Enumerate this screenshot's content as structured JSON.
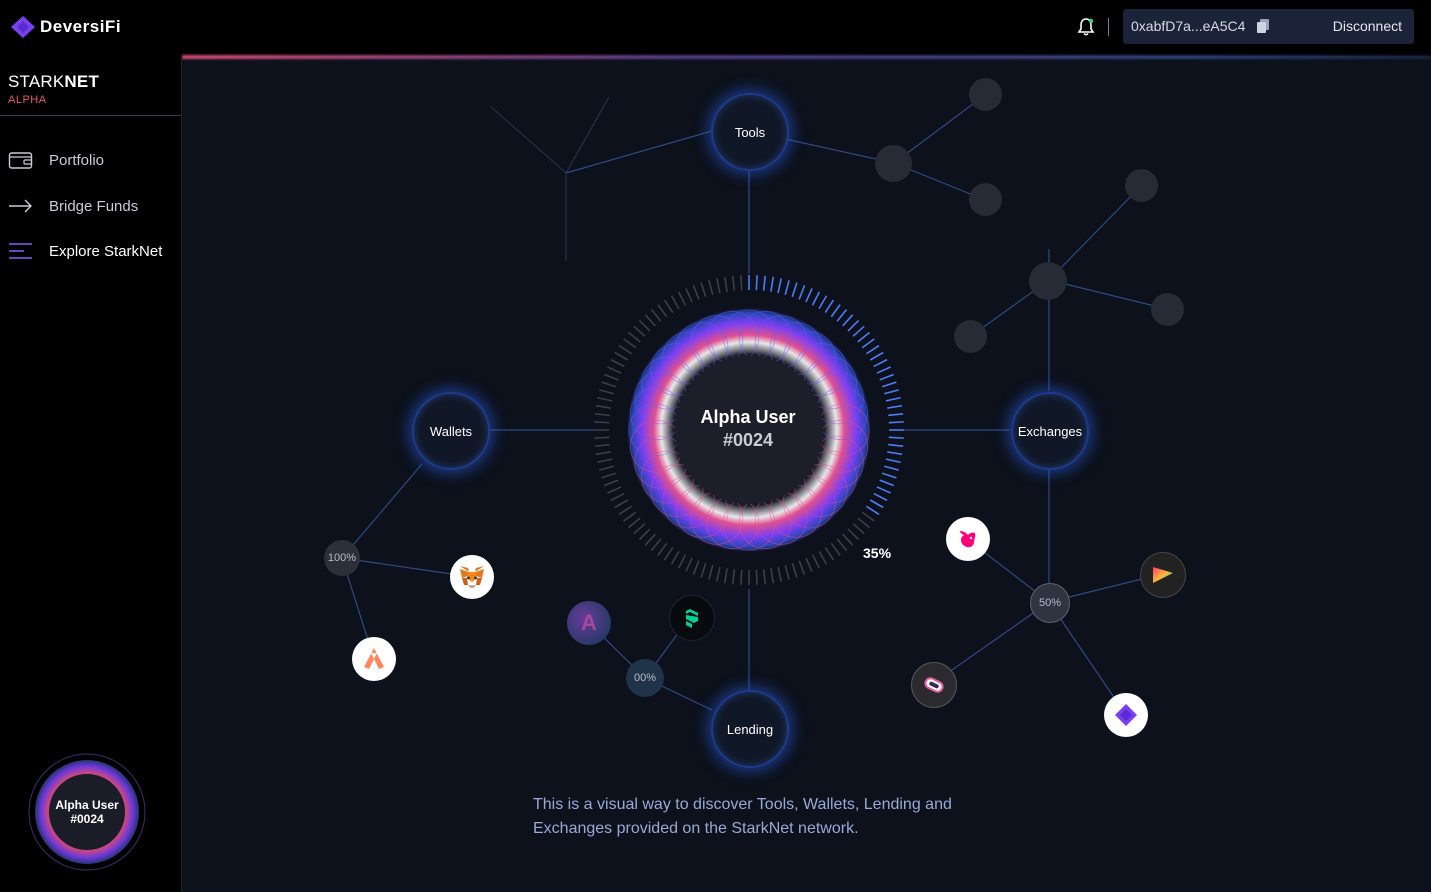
{
  "header": {
    "logo_text": "DeversiFi",
    "wallet_address": "0xabfD7a...eA5C4",
    "disconnect_label": "Disconnect"
  },
  "sidebar": {
    "brand_name_light": "STARK",
    "brand_name_bold": "NET",
    "brand_sub": "ALPHA",
    "items": [
      {
        "label": "Portfolio",
        "icon": "wallet-icon"
      },
      {
        "label": "Bridge Funds",
        "icon": "arrow-right-icon"
      },
      {
        "label": "Explore StarkNet",
        "icon": "menu-lines-icon"
      }
    ],
    "user_badge": {
      "line1": "Alpha User",
      "line2": "#0024"
    }
  },
  "graph": {
    "center": {
      "line1": "Alpha User",
      "line2": "#0024"
    },
    "progress": {
      "label": "35%",
      "value": 35
    },
    "hubs": {
      "tools": "Tools",
      "wallets": "Wallets",
      "exchanges": "Exchanges",
      "lending": "Lending"
    },
    "percentages": {
      "wallets": "100%",
      "lending": "00%",
      "exchanges": "50%"
    },
    "apps": {
      "wallets": [
        "metamask-icon",
        "argent-icon"
      ],
      "lending": [
        "aave-icon",
        "compound-icon"
      ],
      "exchanges": [
        "uniswap-icon",
        "sushiswap-icon",
        "zkswap-icon",
        "deversifi-icon"
      ]
    },
    "caption": "This is a visual way to discover Tools, Wallets, Lending and Exchanges provided on the StarkNet network."
  },
  "colors": {
    "background": "#0c111b",
    "accent_blue": "#3b6ef5",
    "accent_purple": "#7b3ff2",
    "alpha_red": "#e65a5a"
  }
}
